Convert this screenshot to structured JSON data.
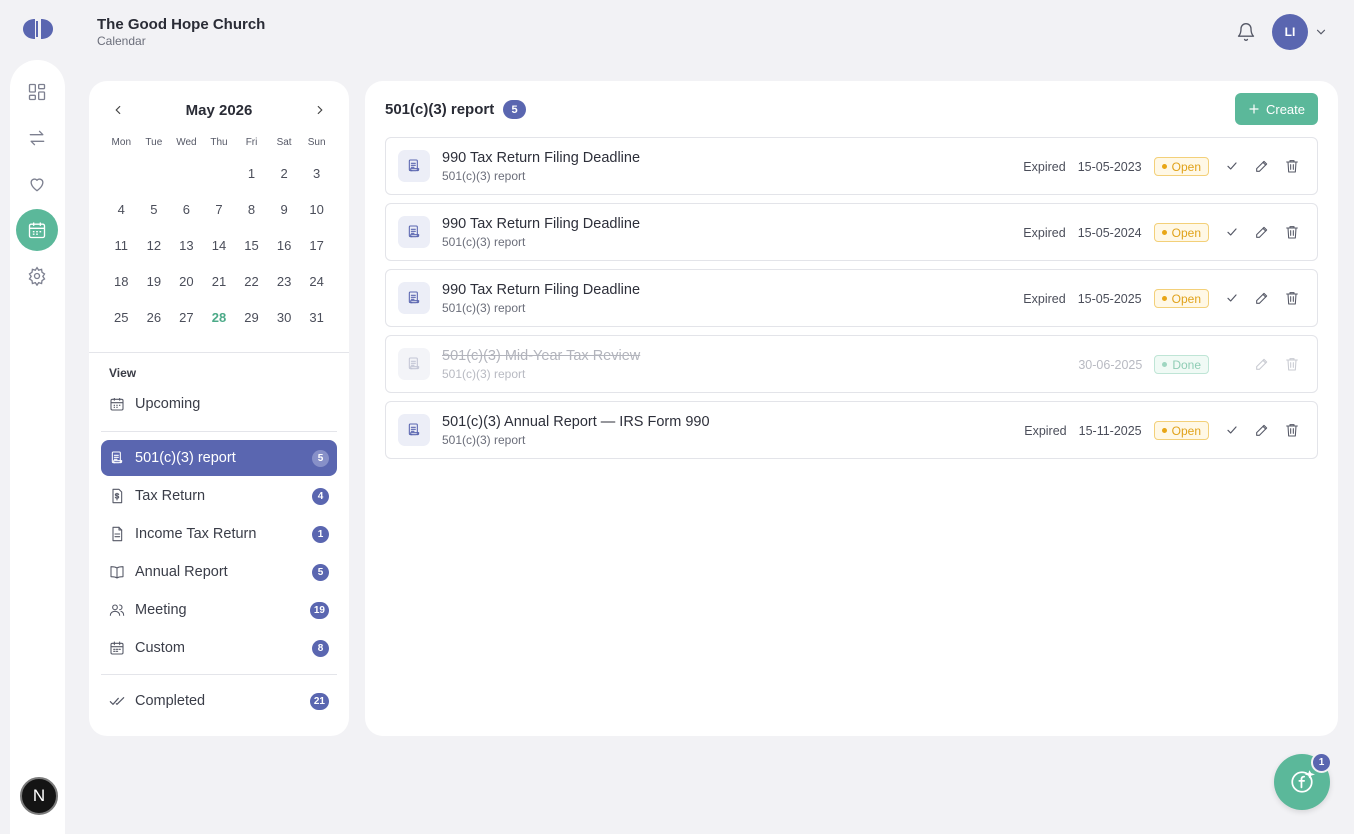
{
  "header": {
    "org_name": "The Good Hope Church",
    "section": "Calendar",
    "avatar_initials": "LI"
  },
  "rail": {
    "items": [
      "dashboard-icon",
      "transfer-icon",
      "heart-icon",
      "calendar-icon",
      "gear-icon"
    ],
    "active": "calendar-icon",
    "bottom_avatar": "N"
  },
  "calendar": {
    "month_label": "May 2026",
    "weekdays": [
      "Mon",
      "Tue",
      "Wed",
      "Thu",
      "Fri",
      "Sat",
      "Sun"
    ],
    "days": [
      "",
      "",
      "",
      "",
      "1",
      "2",
      "3",
      "4",
      "5",
      "6",
      "7",
      "8",
      "9",
      "10",
      "11",
      "12",
      "13",
      "14",
      "15",
      "16",
      "17",
      "18",
      "19",
      "20",
      "21",
      "22",
      "23",
      "24",
      "25",
      "26",
      "27",
      "28",
      "29",
      "30",
      "31"
    ],
    "today": "28"
  },
  "view": {
    "label": "View",
    "upcoming": "Upcoming",
    "categories": [
      {
        "label": "501(c)(3) report",
        "count": "5",
        "icon": "scroll-icon",
        "active": true
      },
      {
        "label": "Tax Return",
        "count": "4",
        "icon": "dollar-doc-icon"
      },
      {
        "label": "Income Tax Return",
        "count": "1",
        "icon": "document-icon"
      },
      {
        "label": "Annual Report",
        "count": "5",
        "icon": "book-icon"
      },
      {
        "label": "Meeting",
        "count": "19",
        "icon": "users-icon"
      },
      {
        "label": "Custom",
        "count": "8",
        "icon": "calendar-icon"
      }
    ],
    "completed": {
      "label": "Completed",
      "count": "21"
    }
  },
  "main": {
    "title": "501(c)(3) report",
    "count": "5",
    "create_label": "Create",
    "events": [
      {
        "title": "990 Tax Return Filing Deadline",
        "subtitle": "501(c)(3) report",
        "expired": "Expired",
        "date": "15-05-2023",
        "status": "Open",
        "done": false
      },
      {
        "title": "990 Tax Return Filing Deadline",
        "subtitle": "501(c)(3) report",
        "expired": "Expired",
        "date": "15-05-2024",
        "status": "Open",
        "done": false
      },
      {
        "title": "990 Tax Return Filing Deadline",
        "subtitle": "501(c)(3) report",
        "expired": "Expired",
        "date": "15-05-2025",
        "status": "Open",
        "done": false
      },
      {
        "title": "501(c)(3) Mid-Year Tax Review",
        "subtitle": "501(c)(3) report",
        "expired": "",
        "date": "30-06-2025",
        "status": "Done",
        "done": true
      },
      {
        "title": "501(c)(3) Annual Report — IRS Form 990",
        "subtitle": "501(c)(3) report",
        "expired": "Expired",
        "date": "15-11-2025",
        "status": "Open",
        "done": false
      }
    ]
  },
  "fab": {
    "badge": "1"
  },
  "colors": {
    "accent_green": "#5bb89a",
    "accent_indigo": "#5a66b0",
    "open_amber": "#e0a21a",
    "background": "#f2f2f5"
  }
}
